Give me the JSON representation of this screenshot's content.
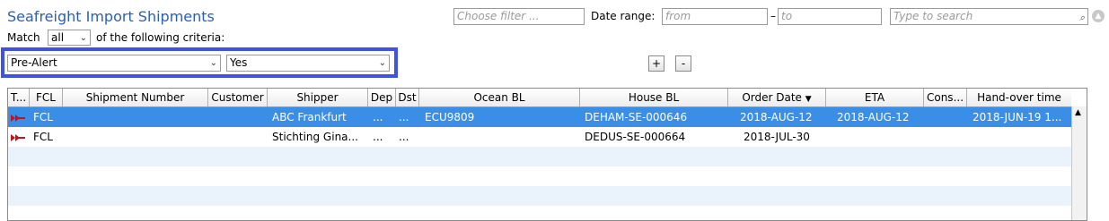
{
  "header": {
    "title": "Seafreight Import Shipments"
  },
  "filters": {
    "choose_filter_placeholder": "Choose filter ...",
    "date_range_label": "Date range:",
    "date_from_placeholder": "from",
    "date_dash": "–",
    "date_to_placeholder": "to",
    "search_placeholder": "Type to search"
  },
  "criteria": {
    "match_label": "Match",
    "match_value": "all",
    "suffix_label": "of the following criteria:",
    "field_value": "Pre-Alert",
    "condition_value": "Yes",
    "add_label": "+",
    "remove_label": "-"
  },
  "table": {
    "columns": [
      "T...",
      "FCL",
      "Shipment Number",
      "Customer",
      "Shipper",
      "Dep",
      "Dst",
      "Ocean BL",
      "House BL",
      "Order Date",
      "ETA",
      "Cons...",
      "Hand-over time"
    ],
    "sort_indicator": "▼",
    "rows": [
      {
        "fcl": "FCL",
        "shipment": "",
        "customer": "",
        "shipper": "ABC Frankfurt",
        "dep": "...",
        "dst": "...",
        "ocean_bl": "ECU9809",
        "house_bl": "DEHAM-SE-000646",
        "order_date": "2018-AUG-12",
        "eta": "2018-AUG-12",
        "cons": "",
        "handover": "2018-JUN-19 1..."
      },
      {
        "fcl": "FCL",
        "shipment": "",
        "customer": "",
        "shipper": "Stichting Gina...",
        "dep": "...",
        "dst": "...",
        "ocean_bl": "",
        "house_bl": "DEDUS-SE-000664",
        "order_date": "2018-JUL-30",
        "eta": "",
        "cons": "",
        "handover": ""
      }
    ]
  },
  "colors": {
    "selected_row": "#3a8ee6",
    "alt_row": "#eaf3fb",
    "title": "#2a5fb4",
    "highlight_border": "#3f51e6",
    "arrow_icon": "#c0141b"
  }
}
